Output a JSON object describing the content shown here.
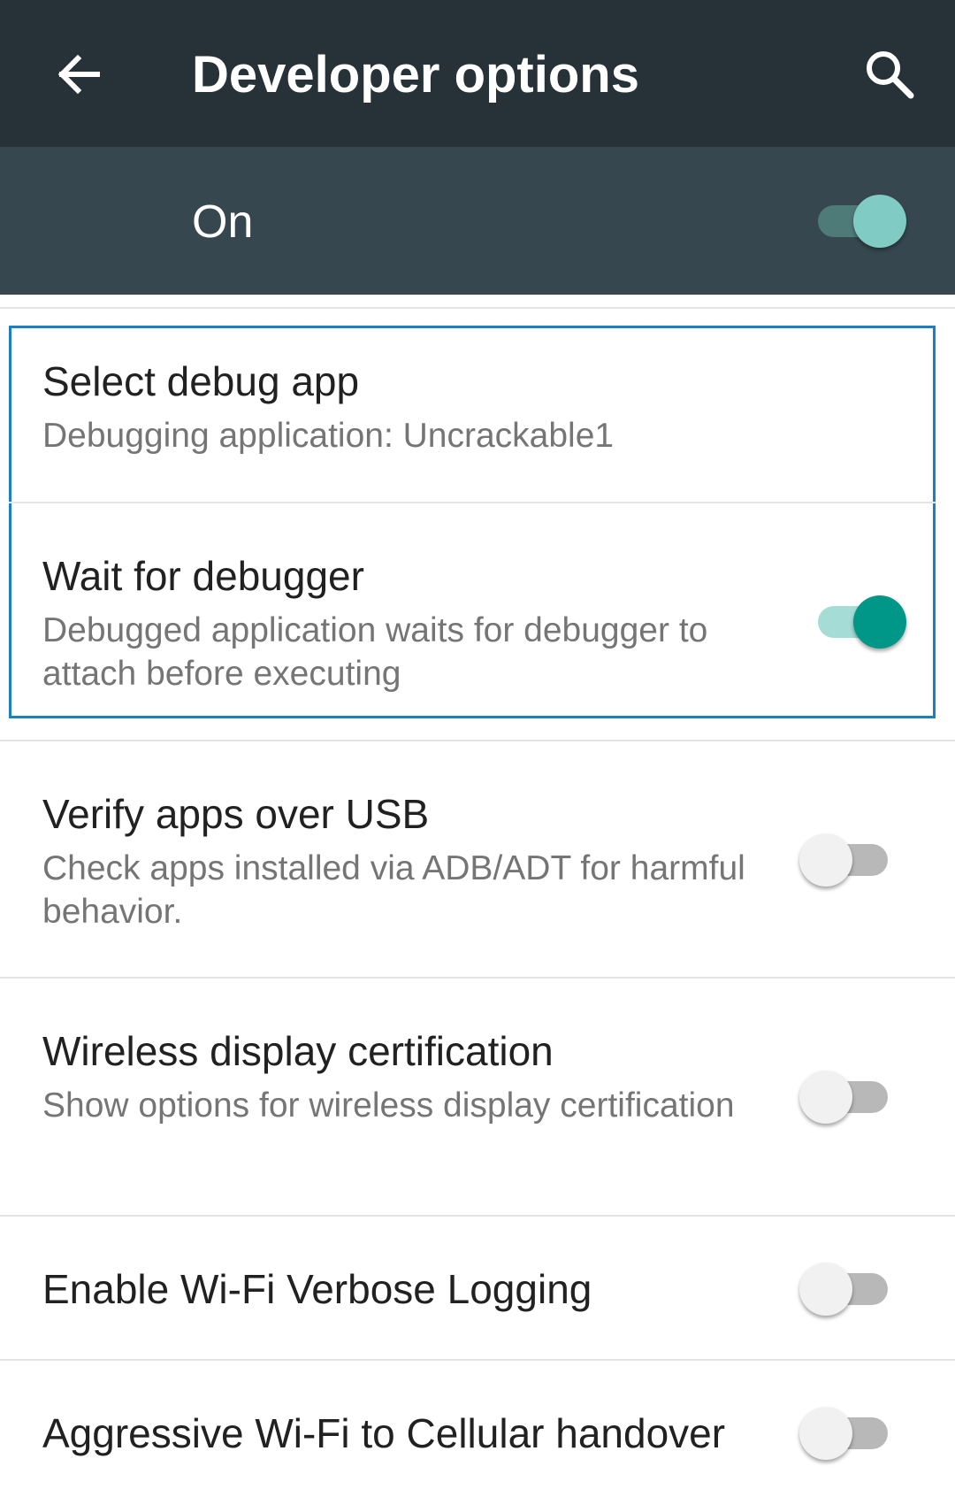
{
  "app_bar": {
    "title": "Developer options",
    "back_icon": "arrow-back-icon",
    "search_icon": "search-icon",
    "background": "#263238"
  },
  "master_switch": {
    "label": "On",
    "state": true,
    "background": "#37474f"
  },
  "settings": [
    {
      "title": "Select debug app",
      "summary": "Debugging application: Uncrackable1"
    },
    {
      "title": "Wait for debugger",
      "summary": "Debugged application waits for debugger to attach before executing",
      "switch": true
    },
    {
      "title": "Verify apps over USB",
      "summary": "Check apps installed via ADB/ADT for harmful behavior.",
      "switch": false
    },
    {
      "title": "Wireless display certification",
      "summary": "Show options for wireless display certification",
      "switch": false
    },
    {
      "title": "Enable Wi-Fi Verbose Logging",
      "switch": false
    },
    {
      "title": "Aggressive Wi-Fi to Cellular handover",
      "switch": false
    }
  ],
  "colors": {
    "accent": "#009688",
    "highlight_border": "#1b7fc4"
  }
}
